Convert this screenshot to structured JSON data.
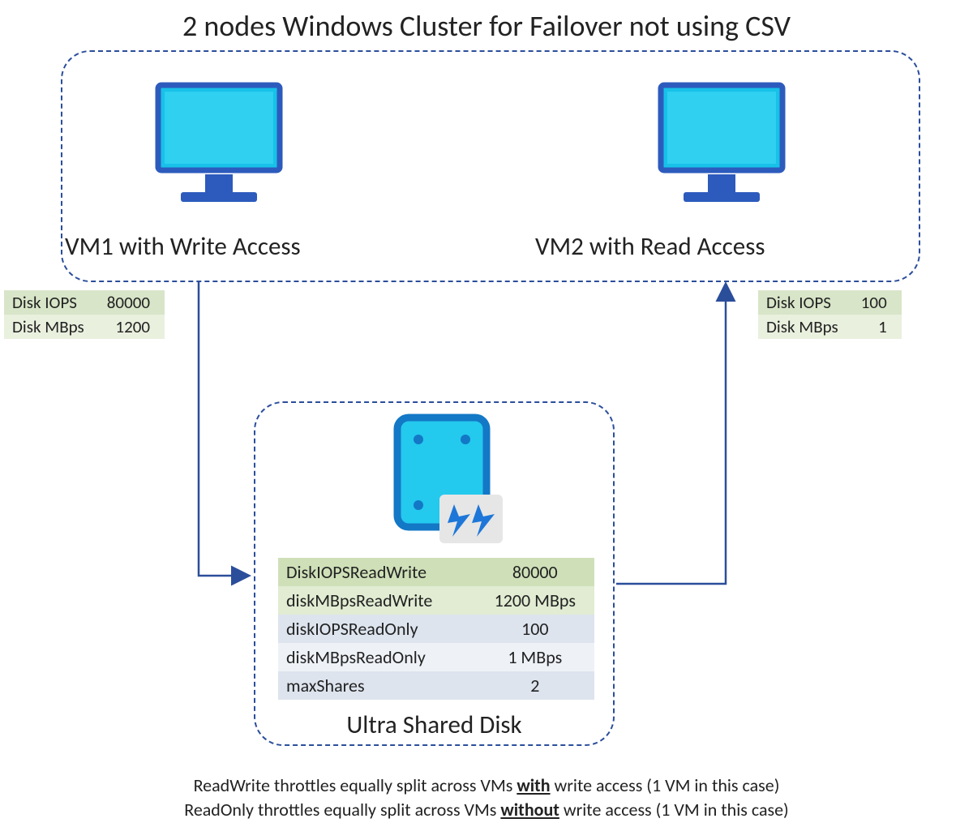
{
  "title": "2 nodes Windows Cluster for Failover not using CSV",
  "vm1": {
    "label": "VM1 with Write Access",
    "iops_label": "Disk IOPS",
    "iops_value": "80000",
    "mbps_label": "Disk MBps",
    "mbps_value": "1200"
  },
  "vm2": {
    "label": "VM2 with Read Access",
    "iops_label": "Disk IOPS",
    "iops_value": "100",
    "mbps_label": "Disk MBps",
    "mbps_value": "1"
  },
  "disk": {
    "label": "Ultra Shared Disk",
    "rows": {
      "r1k": "DiskIOPSReadWrite",
      "r1v": "80000",
      "r2k": "diskMBpsReadWrite",
      "r2v": "1200 MBps",
      "r3k": "diskIOPSReadOnly",
      "r3v": "100",
      "r4k": "diskMBpsReadOnly",
      "r4v": "1 MBps",
      "r5k": "maxShares",
      "r5v": "2"
    }
  },
  "footnotes": {
    "line1_a": "ReadWrite throttles equally split across VMs ",
    "line1_b": "with",
    "line1_c": " write access (1 VM in this case)",
    "line2_a": "ReadOnly throttles equally split across VMs ",
    "line2_b": "without",
    "line2_c": " write access (1 VM in this case)"
  }
}
